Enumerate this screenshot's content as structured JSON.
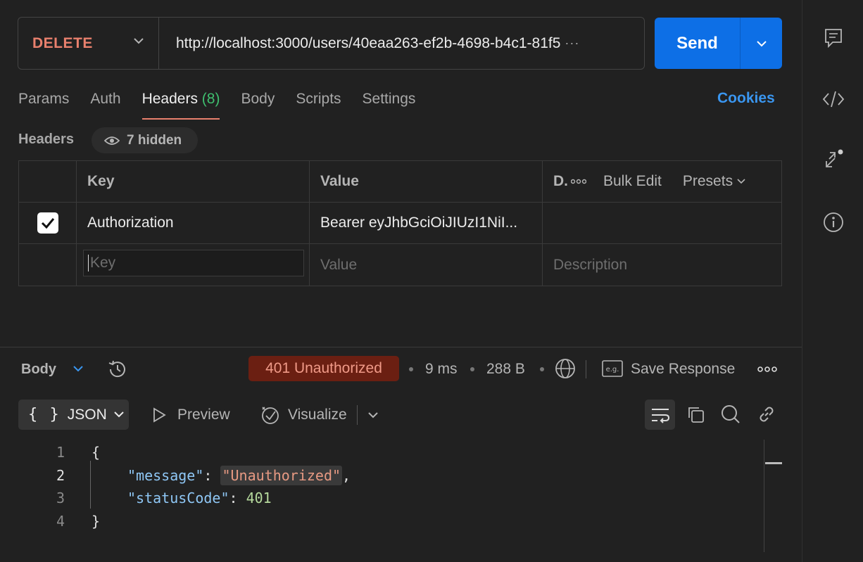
{
  "request": {
    "method": "DELETE",
    "url": "http://localhost:3000/users/40eaa263-ef2b-4698-b4c1-81f5",
    "url_overflow": "···",
    "send_label": "Send"
  },
  "tabs": [
    {
      "label": "Params"
    },
    {
      "label": "Auth"
    },
    {
      "label": "Headers",
      "count": "(8)"
    },
    {
      "label": "Body"
    },
    {
      "label": "Scripts"
    },
    {
      "label": "Settings"
    }
  ],
  "cookies_label": "Cookies",
  "headers_section": {
    "title": "Headers",
    "hidden_label": "7 hidden",
    "columns": {
      "key": "Key",
      "value": "Value",
      "description": "D."
    },
    "bulk_edit": "Bulk Edit",
    "presets": "Presets",
    "rows": [
      {
        "checked": true,
        "key": "Authorization",
        "value": "Bearer eyJhbGciOiJIUzI1NiI..."
      }
    ],
    "new_row": {
      "key_placeholder": "Key",
      "value_placeholder": "Value",
      "description_placeholder": "Description"
    }
  },
  "response": {
    "body_label": "Body",
    "status": "401 Unauthorized",
    "time": "9 ms",
    "size": "288 B",
    "save_label": "Save Response",
    "format": "JSON",
    "format_braces": "{ }",
    "preview_label": "Preview",
    "visualize_label": "Visualize",
    "code_lines": [
      {
        "n": "1",
        "text": "{"
      },
      {
        "n": "2",
        "key": "\"message\"",
        "value": "\"Unauthorized\""
      },
      {
        "n": "3",
        "key": "\"statusCode\"",
        "value": "401"
      },
      {
        "n": "4",
        "text": "}"
      }
    ]
  },
  "colors": {
    "method": "#e8806d",
    "send": "#0d6fe6",
    "status_bg": "#6b1f12",
    "tab_underline": "#e8806d",
    "count": "#3fbf6f",
    "cookies": "#3a96f0"
  },
  "icons": [
    "comment-icon",
    "code-icon",
    "related-icon",
    "info-icon",
    "history-icon",
    "globe-icon",
    "save-icon",
    "more-icon",
    "play-icon",
    "visualize-icon",
    "wrap-icon",
    "copy-icon",
    "search-icon",
    "link-icon"
  ]
}
